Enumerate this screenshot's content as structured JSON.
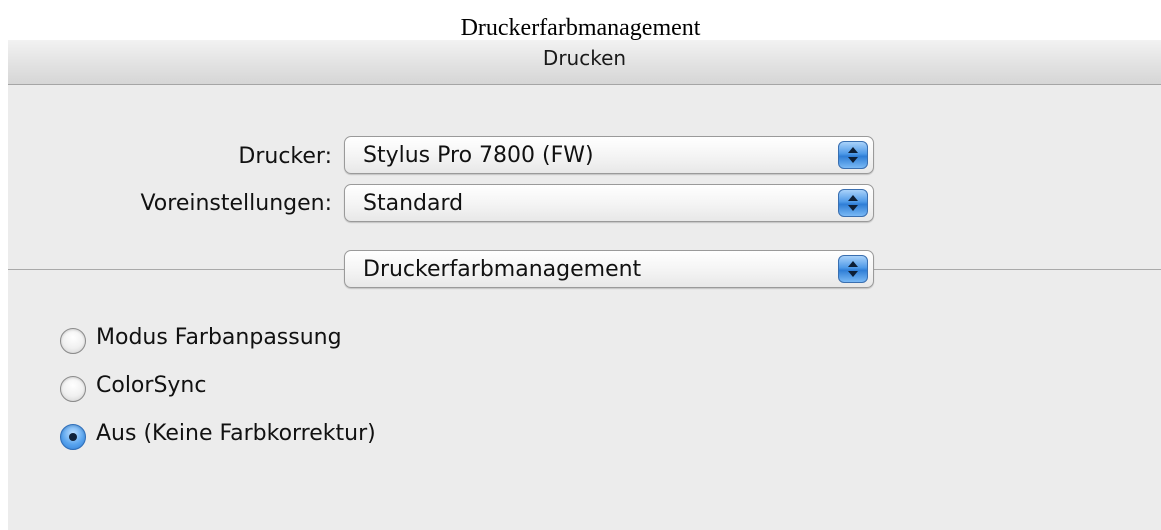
{
  "caption": "Druckerfarbmanagement",
  "window": {
    "title": "Drucken"
  },
  "printer": {
    "label": "Drucker:",
    "value": "Stylus Pro 7800 (FW)"
  },
  "presets": {
    "label": "Voreinstellungen:",
    "value": "Standard"
  },
  "panel": {
    "value": "Druckerfarbmanagement"
  },
  "color_mode": {
    "options": [
      {
        "label": "Modus Farbanpassung",
        "selected": false
      },
      {
        "label": "ColorSync",
        "selected": false
      },
      {
        "label": "Aus (Keine Farbkorrektur)",
        "selected": true
      }
    ]
  },
  "icons": {
    "popup_arrows": "up-down-arrows-icon"
  },
  "colors": {
    "accent_blue": "#4f9ae8",
    "window_bg": "#ececec"
  }
}
